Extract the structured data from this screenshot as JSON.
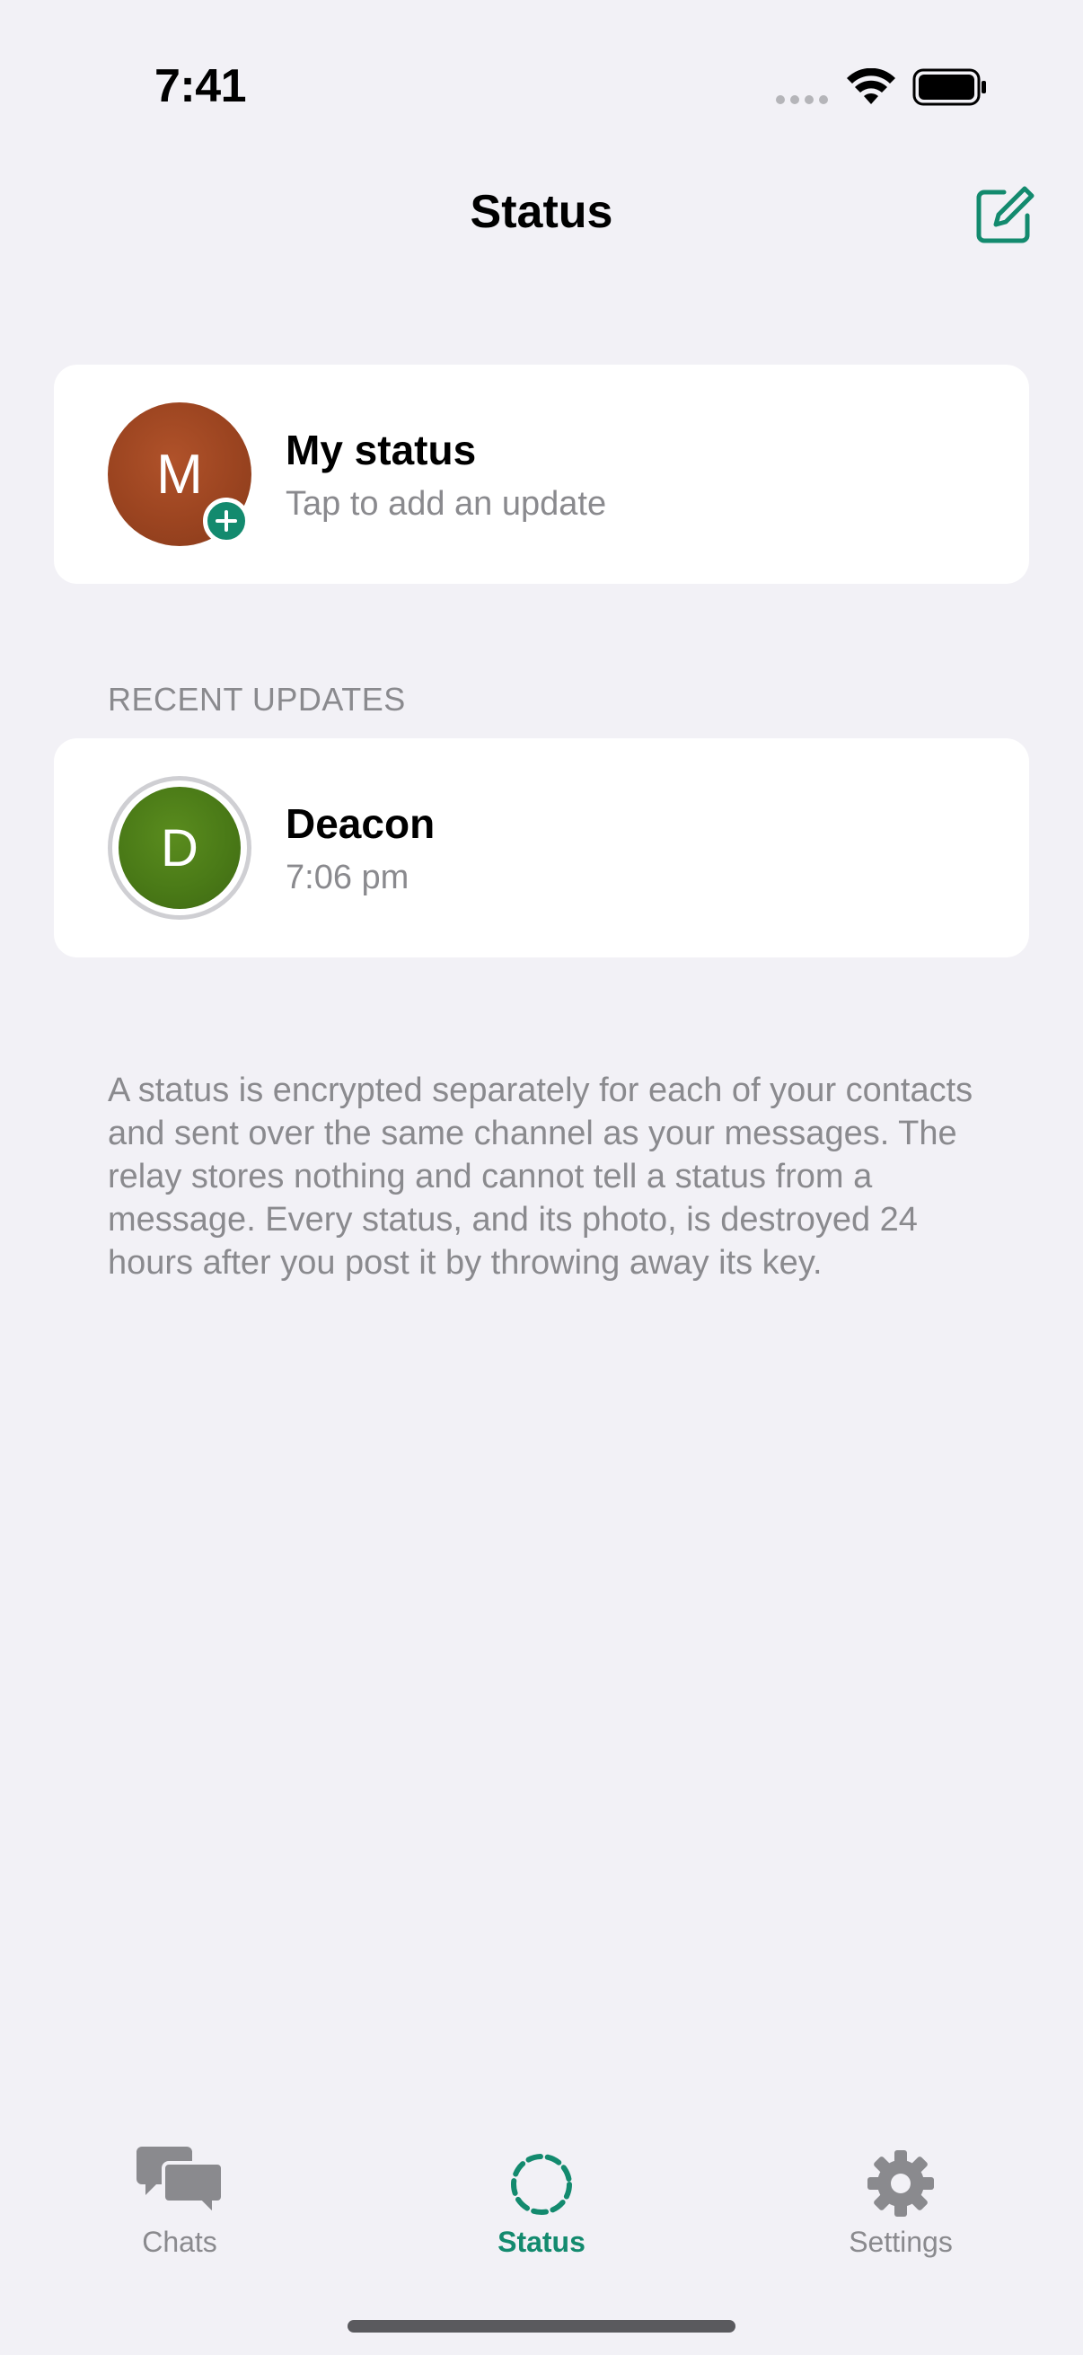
{
  "status_bar": {
    "time": "7:41"
  },
  "nav": {
    "title": "Status"
  },
  "my_status": {
    "avatar_letter": "M",
    "title": "My status",
    "subtitle": "Tap to add an update"
  },
  "recent": {
    "section_label": "RECENT UPDATES",
    "items": [
      {
        "avatar_letter": "D",
        "name": "Deacon",
        "time": "7:06 pm"
      }
    ]
  },
  "footnote": "A status is encrypted separately for each of your contacts and sent over the same channel as your messages. The relay stores nothing and cannot tell a status from a message. Every status, and its photo, is destroyed 24 hours after you post it by throwing away its key.",
  "tab_bar": {
    "tabs": [
      {
        "label": "Chats",
        "icon": "chat-bubbles-icon",
        "active": false
      },
      {
        "label": "Status",
        "icon": "status-ring-icon",
        "active": true
      },
      {
        "label": "Settings",
        "icon": "gear-icon",
        "active": false
      }
    ]
  },
  "colors": {
    "accent": "#138a6e",
    "background": "#f2f1f6",
    "secondary_text": "#8a8a8e",
    "avatar_m": "#9b4420",
    "avatar_d": "#4a7a17"
  }
}
